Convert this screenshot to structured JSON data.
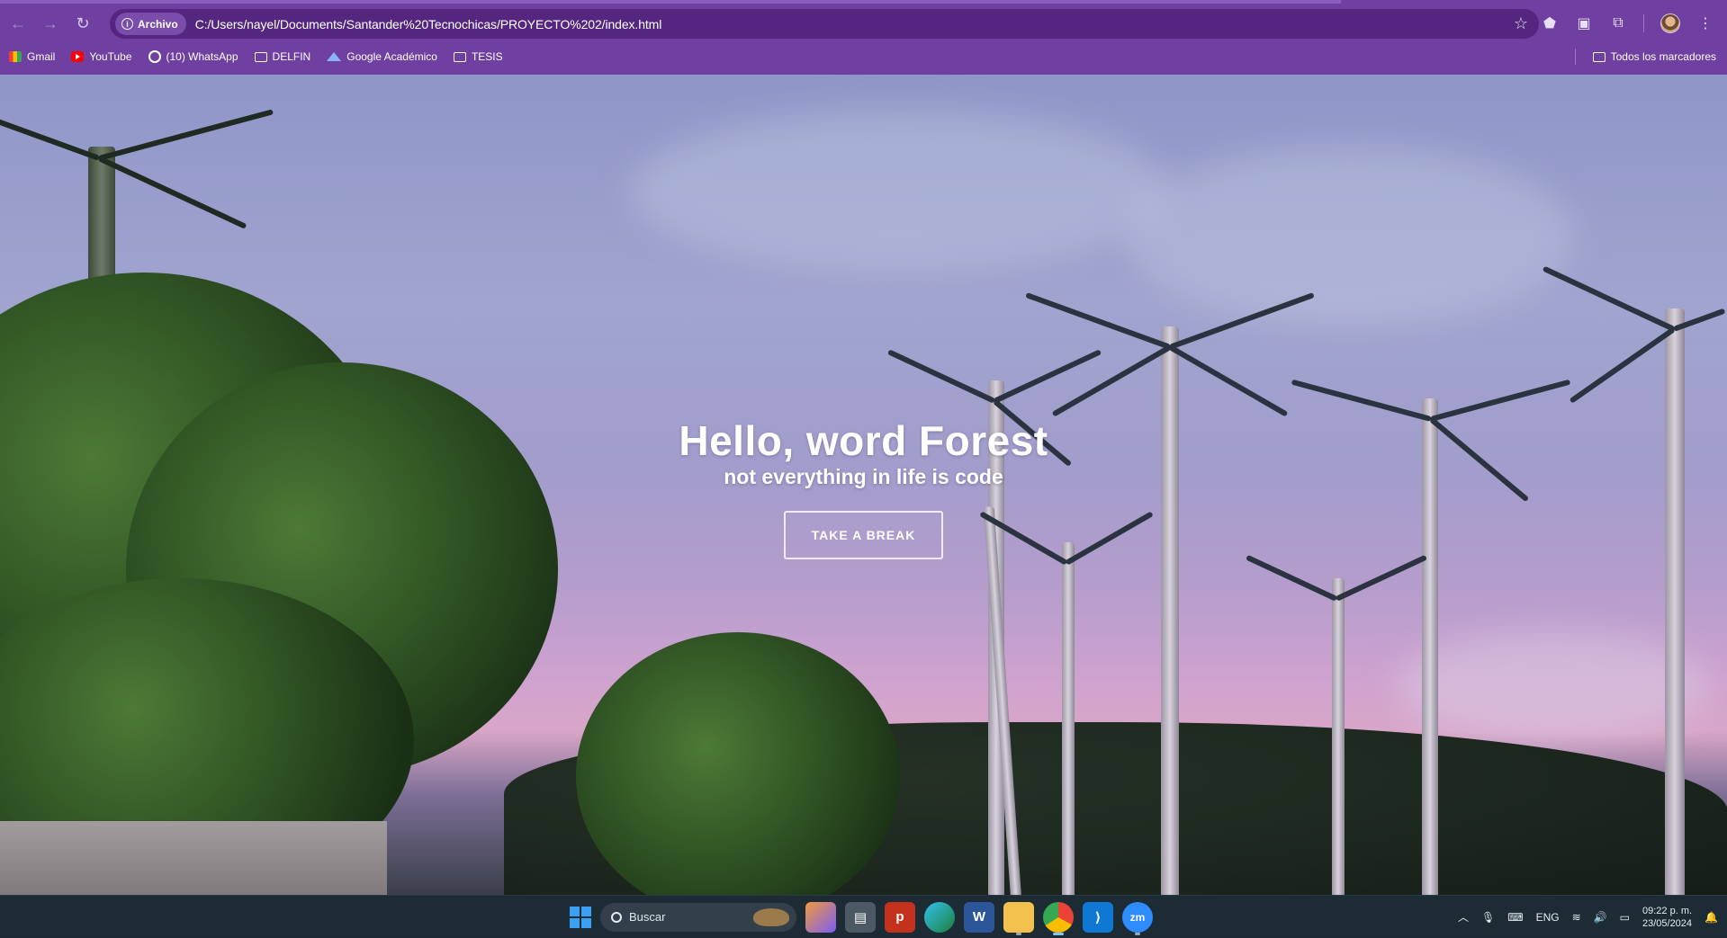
{
  "browser": {
    "nav": {
      "back": "←",
      "forward": "→",
      "reload": "↻"
    },
    "address": {
      "chip_label": "Archivo",
      "url": "C:/Users/nayel/Documents/Santander%20Tecnochicas/PROYECTO%202/index.html"
    },
    "toolbar_icons": [
      "bookmark-star-icon",
      "shield-extension-icon",
      "extension-icon",
      "puzzle-icon",
      "profile-avatar",
      "kebab-menu-icon"
    ]
  },
  "bookmarks": {
    "items": [
      {
        "label": "Gmail",
        "icon": "gmail-icon"
      },
      {
        "label": "YouTube",
        "icon": "youtube-icon"
      },
      {
        "label": "(10) WhatsApp",
        "icon": "whatsapp-icon"
      },
      {
        "label": "DELFIN",
        "icon": "folder-icon"
      },
      {
        "label": "Google Académico",
        "icon": "scholar-icon"
      },
      {
        "label": "TESIS",
        "icon": "folder-icon"
      }
    ],
    "all_bookmarks": "Todos los marcadores"
  },
  "page": {
    "title": "Hello, word Forest",
    "subtitle": "not everything in life is code",
    "button": "TAKE A BREAK"
  },
  "taskbar": {
    "search_placeholder": "Buscar",
    "apps": [
      "copilot-icon",
      "task-view-icon",
      "app-p-icon",
      "edge-icon",
      "word-icon",
      "file-explorer-icon",
      "chrome-icon",
      "vscode-icon",
      "zoom-icon"
    ],
    "tray": {
      "language": "ENG",
      "time": "09:22 p. m.",
      "date": "23/05/2024"
    }
  },
  "colors": {
    "chrome_frame": "#6f3fa1",
    "omnibox": "#55267f",
    "taskbar": "#1d2b35"
  }
}
